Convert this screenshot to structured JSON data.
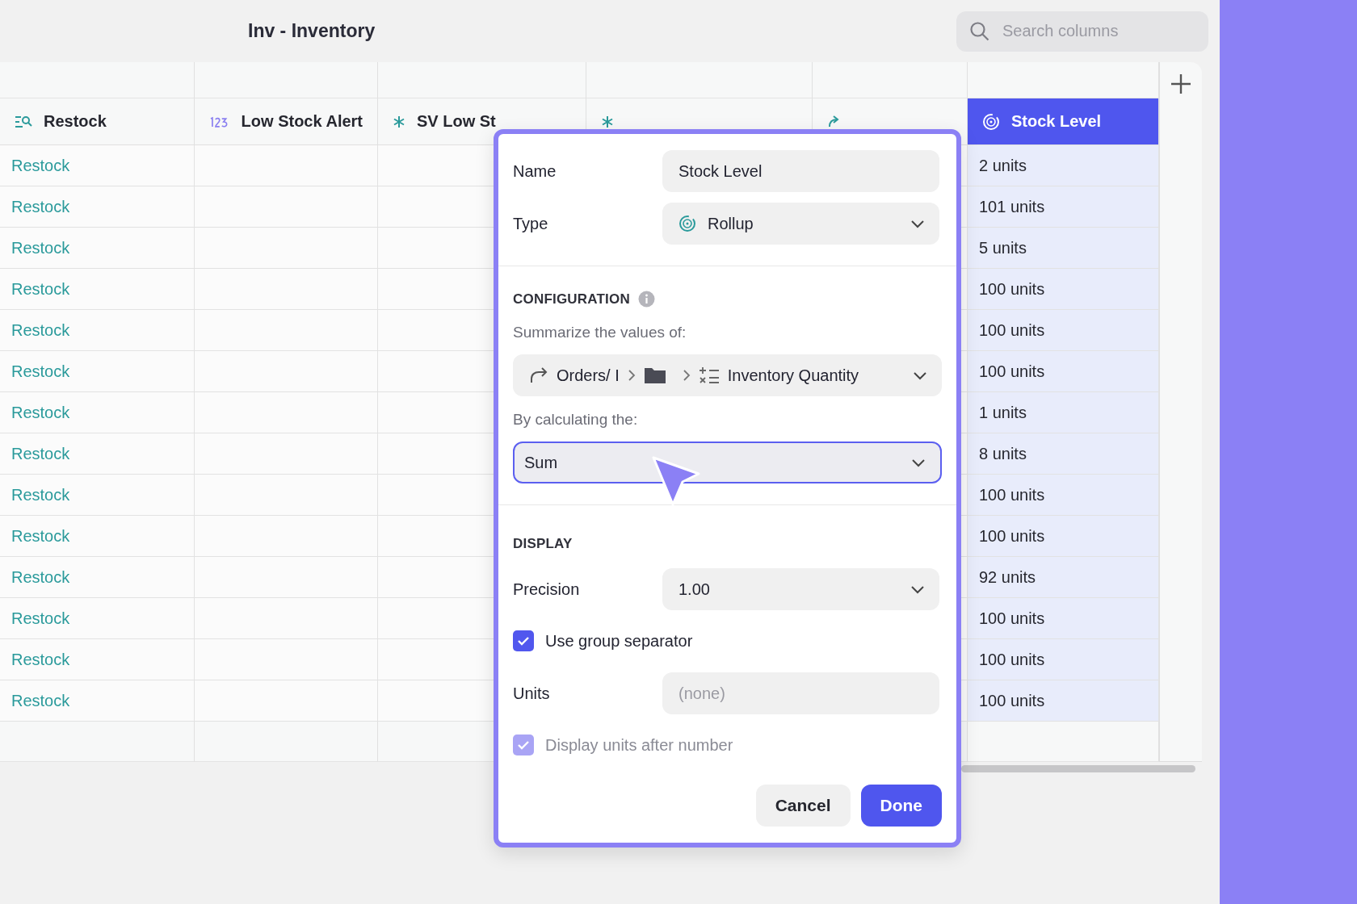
{
  "title": "Inv - Inventory",
  "search": {
    "placeholder": "Search columns"
  },
  "table": {
    "columns": [
      {
        "kind": "lookup",
        "label": "Restock",
        "selected": false
      },
      {
        "kind": "number",
        "label": "Low Stock Alert",
        "selected": false
      },
      {
        "kind": "formula",
        "label": "SV Low St",
        "selected": false
      },
      {
        "kind": "formula",
        "selected": false
      },
      {
        "kind": "link",
        "selected": false
      },
      {
        "kind": "rollup",
        "label": "Stock Level",
        "selected": true
      }
    ],
    "rows": [
      {
        "restock": "Restock",
        "stock_level": "2 units"
      },
      {
        "restock": "Restock",
        "stock_level": "101 units"
      },
      {
        "restock": "Restock",
        "stock_level": "5 units"
      },
      {
        "restock": "Restock",
        "stock_level": "100 units"
      },
      {
        "restock": "Restock",
        "stock_level": "100 units"
      },
      {
        "restock": "Restock",
        "stock_level": "100 units"
      },
      {
        "restock": "Restock",
        "stock_level": "1 units"
      },
      {
        "restock": "Restock",
        "stock_level": "8 units"
      },
      {
        "restock": "Restock",
        "stock_level": "100 units"
      },
      {
        "restock": "Restock",
        "stock_level": "100 units"
      },
      {
        "restock": "Restock",
        "stock_level": "92 units"
      },
      {
        "restock": "Restock",
        "stock_level": "100 units"
      },
      {
        "restock": "Restock",
        "stock_level": "100 units"
      },
      {
        "restock": "Restock",
        "stock_level": "100 units"
      }
    ]
  },
  "dialog": {
    "name": {
      "label": "Name",
      "value": "Stock Level"
    },
    "type": {
      "label": "Type",
      "value": "Rollup"
    },
    "configuration": {
      "heading": "CONFIGURATION",
      "summarize_label": "Summarize the values of:",
      "path": {
        "relation": "Orders/ I",
        "field": "Inventory Quantity"
      },
      "calculate_label": "By calculating the:",
      "calculation": {
        "value": "Sum",
        "focused": true
      }
    },
    "display": {
      "heading": "DISPLAY",
      "precision": {
        "label": "Precision",
        "value": "1.00"
      },
      "options": [
        {
          "kind": "checkbox",
          "label": "Use group separator",
          "checked": true,
          "disabled": false
        },
        {
          "kind": "field",
          "label": "Units",
          "placeholder": "(none)"
        },
        {
          "kind": "checkbox",
          "label": "Display units after number",
          "checked": true,
          "disabled": true
        }
      ]
    },
    "buttons": [
      {
        "label": "Cancel",
        "primary": false
      },
      {
        "label": "Done",
        "primary": true
      }
    ]
  }
}
